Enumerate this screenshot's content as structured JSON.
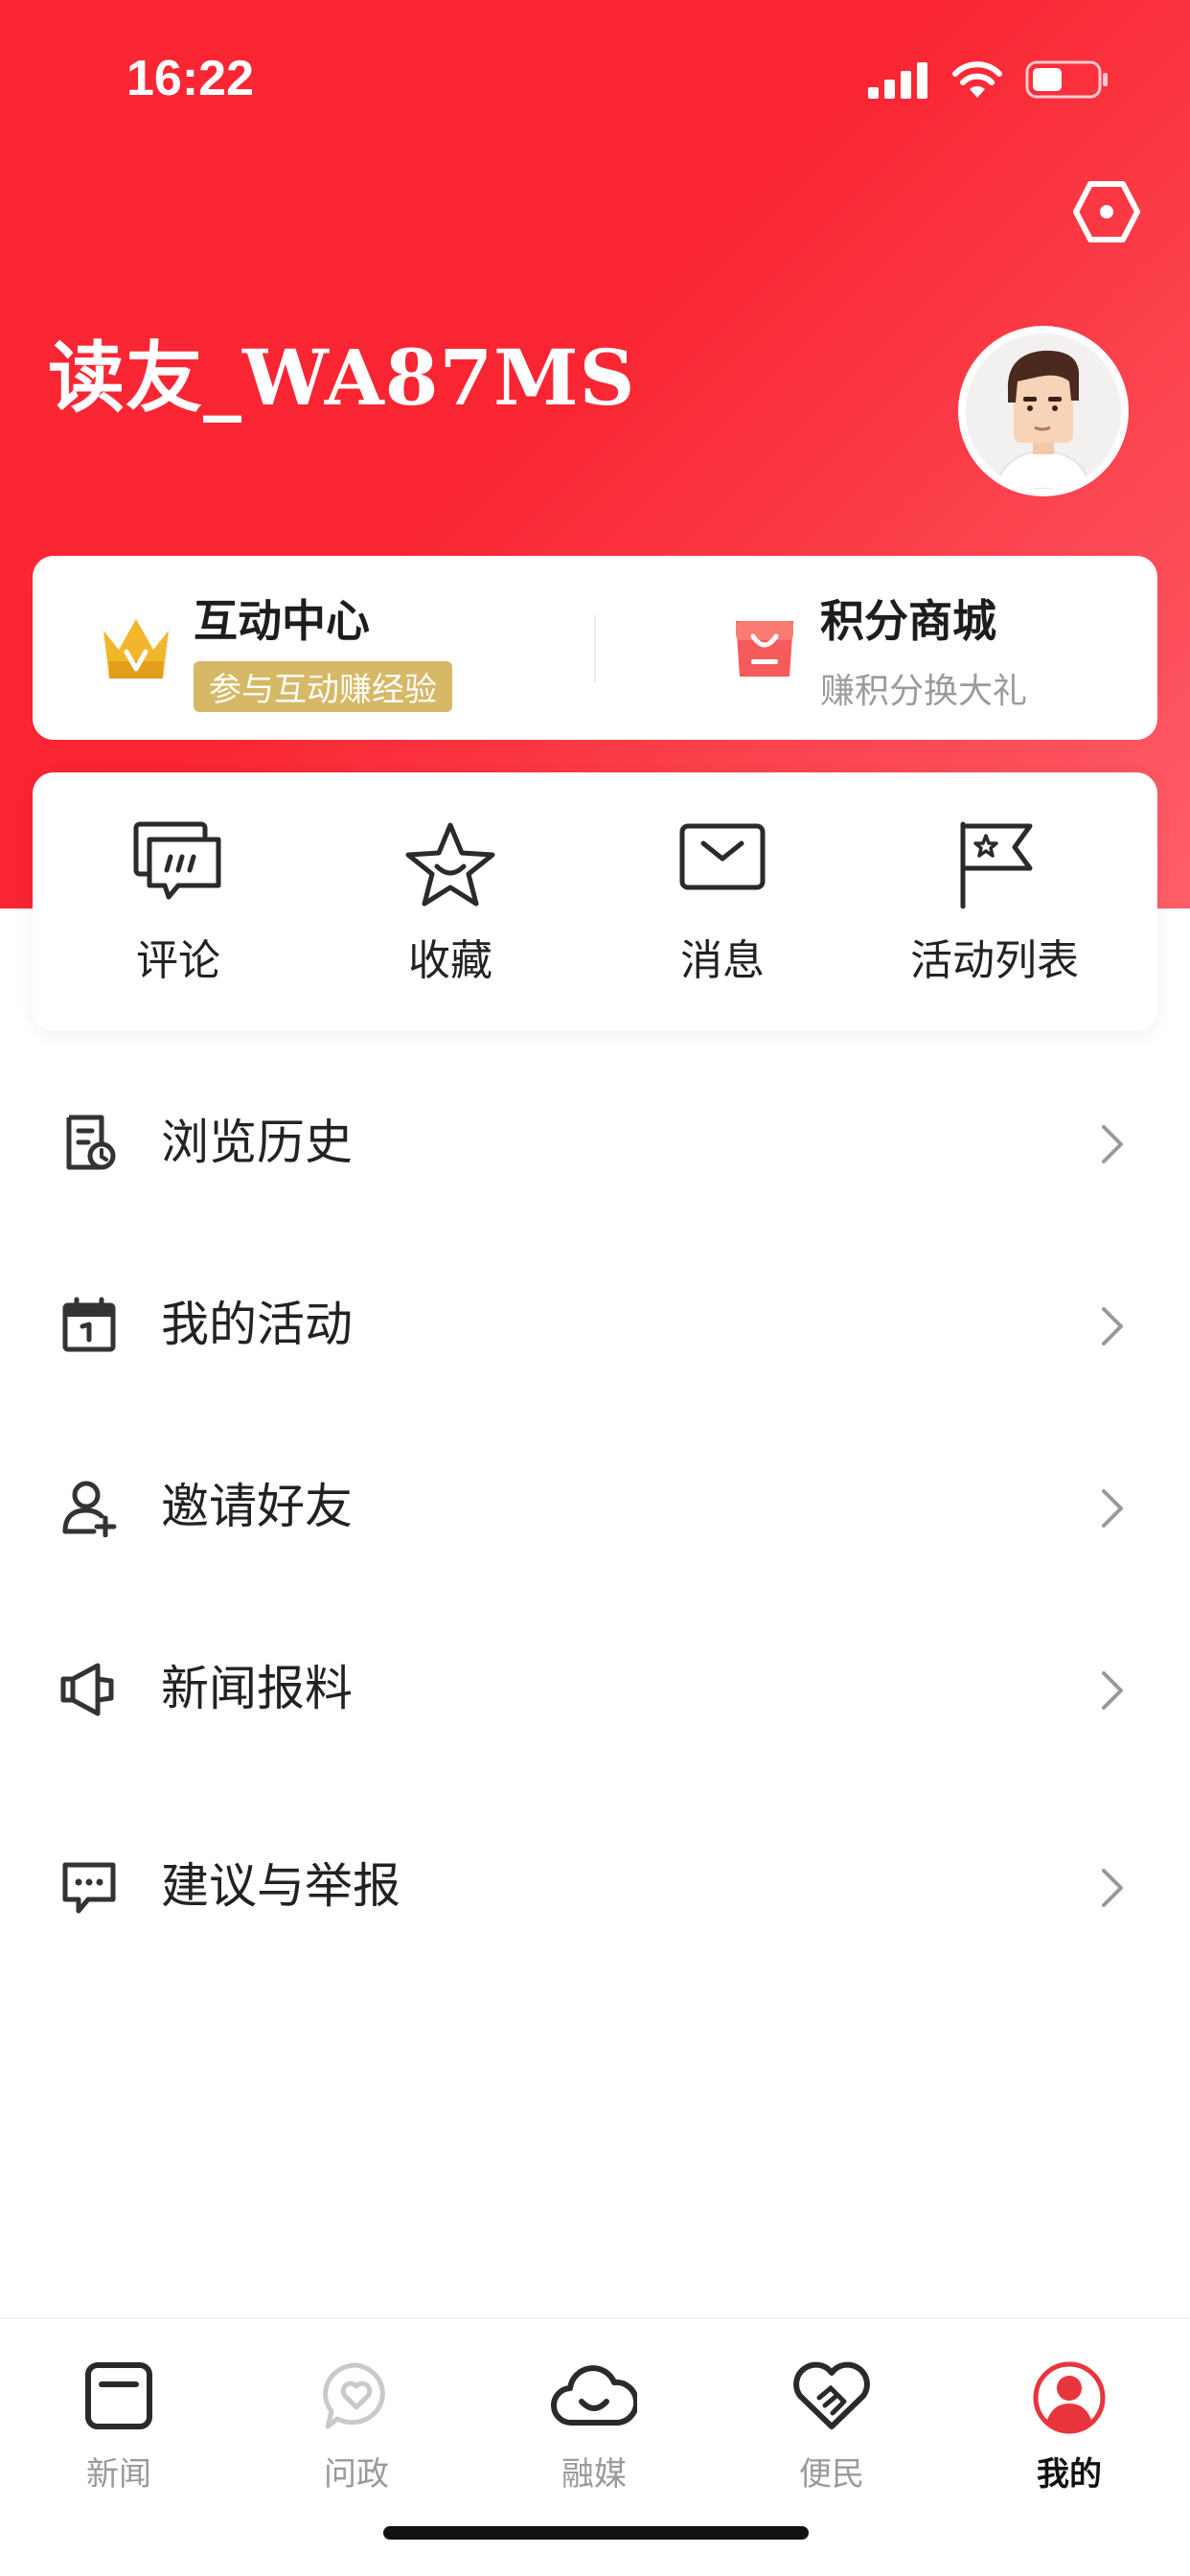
{
  "status_bar": {
    "time": "16:22"
  },
  "profile": {
    "username": "读友_WA87MS"
  },
  "interaction_card": {
    "left": {
      "title": "互动中心",
      "badge": "参与互动赚经验"
    },
    "right": {
      "title": "积分商城",
      "subtitle": "赚积分换大礼"
    }
  },
  "quick_actions": [
    {
      "label": "评论",
      "icon": "comment-icon"
    },
    {
      "label": "收藏",
      "icon": "star-icon"
    },
    {
      "label": "消息",
      "icon": "mail-icon"
    },
    {
      "label": "活动列表",
      "icon": "flag-icon"
    }
  ],
  "menu": [
    {
      "label": "浏览历史",
      "icon": "history-icon"
    },
    {
      "label": "我的活动",
      "icon": "calendar-icon"
    },
    {
      "label": "邀请好友",
      "icon": "add-user-icon"
    },
    {
      "label": "新闻报料",
      "icon": "speaker-icon"
    },
    {
      "label": "建议与举报",
      "icon": "feedback-icon"
    }
  ],
  "tabbar": [
    {
      "label": "新闻",
      "icon": "news-icon"
    },
    {
      "label": "问政",
      "icon": "heart-bubble-icon"
    },
    {
      "label": "融媒",
      "icon": "cloud-icon"
    },
    {
      "label": "便民",
      "icon": "handshake-icon"
    },
    {
      "label": "我的",
      "icon": "user-icon",
      "active": true
    }
  ],
  "colors": {
    "brand_red": "#f92532",
    "gold": "#d6b866",
    "tab_active": "#e8343c",
    "tab_inactive": "#9a9a9a"
  }
}
